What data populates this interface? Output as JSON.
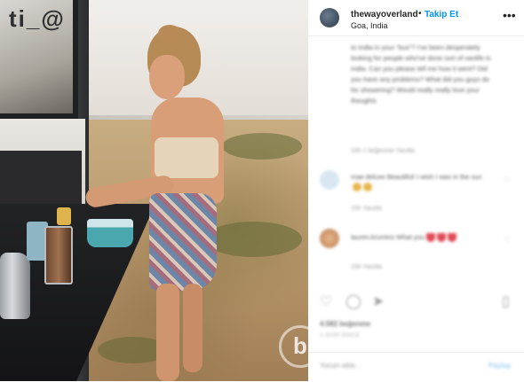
{
  "post": {
    "username": "thewayoverland",
    "separator": "•",
    "follow_label": "Takip Et",
    "location": "Goa, India",
    "more_label": "•••"
  },
  "caption_blurred": "to India in your “bus”? I've been desperately looking for people who've done sort of vanlife in India. Can you please tell me how it went? Did you have any problems? What did you guys do for showering? Would really really love your thoughts",
  "caption_meta": "10h   1 beğenme   Yanıtla",
  "comments": [
    {
      "text": "mae.deluxe Beautiful! I wish I was in the sun",
      "meta": "10h   Yanıtla"
    },
    {
      "text": "lauren.krumins What you",
      "meta": "10h   Yanıtla"
    }
  ],
  "likes_text": "4.582 beğenme",
  "time_text": "1 GÜN ÖNCE",
  "add_comment_placeholder": "Yorum ekle...",
  "post_button": "Paylaş",
  "watermark_letter": "b",
  "van_logo": "ti_@",
  "icons": [
    "more-icon",
    "heart-icon",
    "comment-icon",
    "share-icon",
    "bookmark-icon"
  ]
}
